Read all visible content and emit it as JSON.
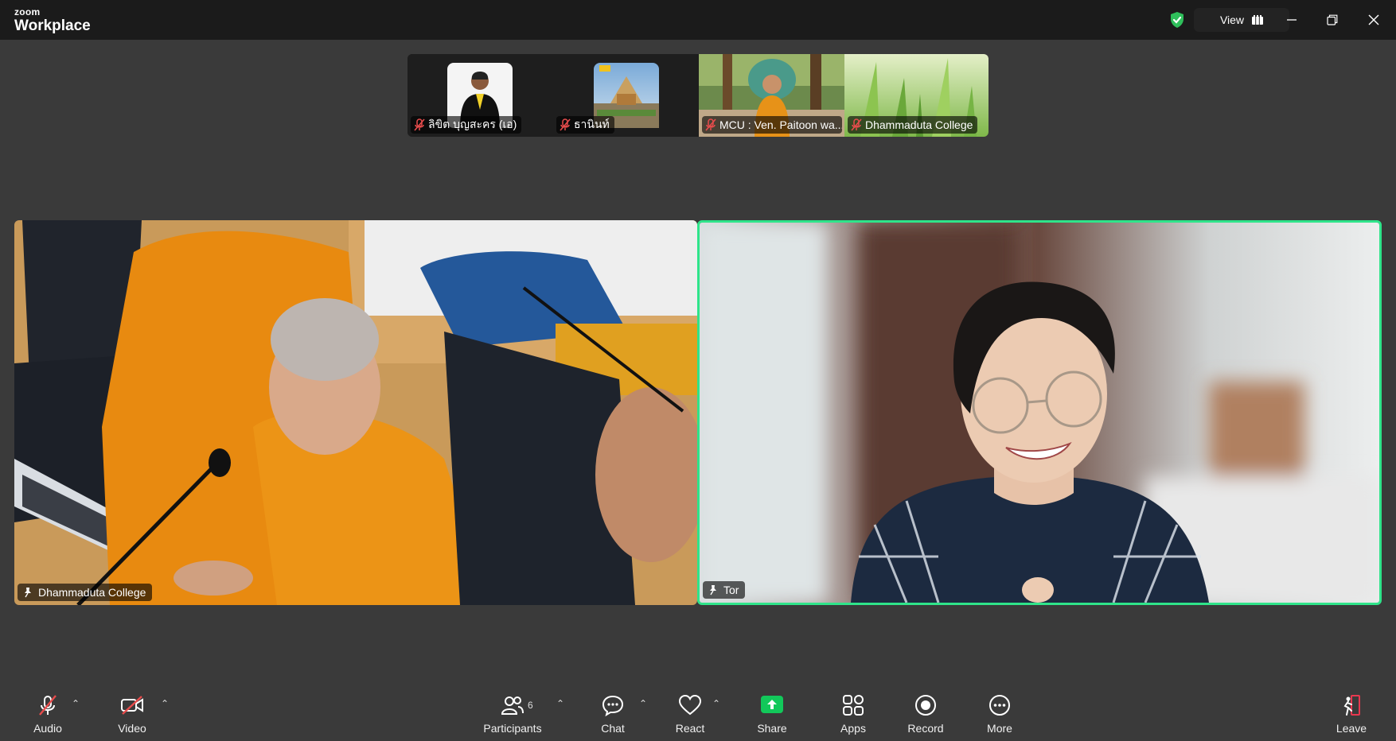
{
  "app": {
    "brand_small": "zoom",
    "brand_large": "Workplace"
  },
  "titlebar": {
    "view_label": "View",
    "secure_color": "#2fbf5b"
  },
  "thumbnails": [
    {
      "name": "ลิขิต บุญสะคร (เอ)"
    },
    {
      "name": "ธานินท์"
    },
    {
      "name": "MCU : Ven. Paitoon wa..."
    },
    {
      "name": "Dhammaduta College"
    }
  ],
  "videos": [
    {
      "label": "Dhammaduta College"
    },
    {
      "label": "Tor",
      "active_speaker": true,
      "border_color": "#2fe48a"
    }
  ],
  "toolbar": {
    "audio": "Audio",
    "video": "Video",
    "participants": "Participants",
    "participant_count": "6",
    "chat": "Chat",
    "react": "React",
    "share": "Share",
    "share_color": "#12c85a",
    "apps": "Apps",
    "record": "Record",
    "more": "More",
    "leave": "Leave",
    "leave_color": "#e8384f"
  }
}
